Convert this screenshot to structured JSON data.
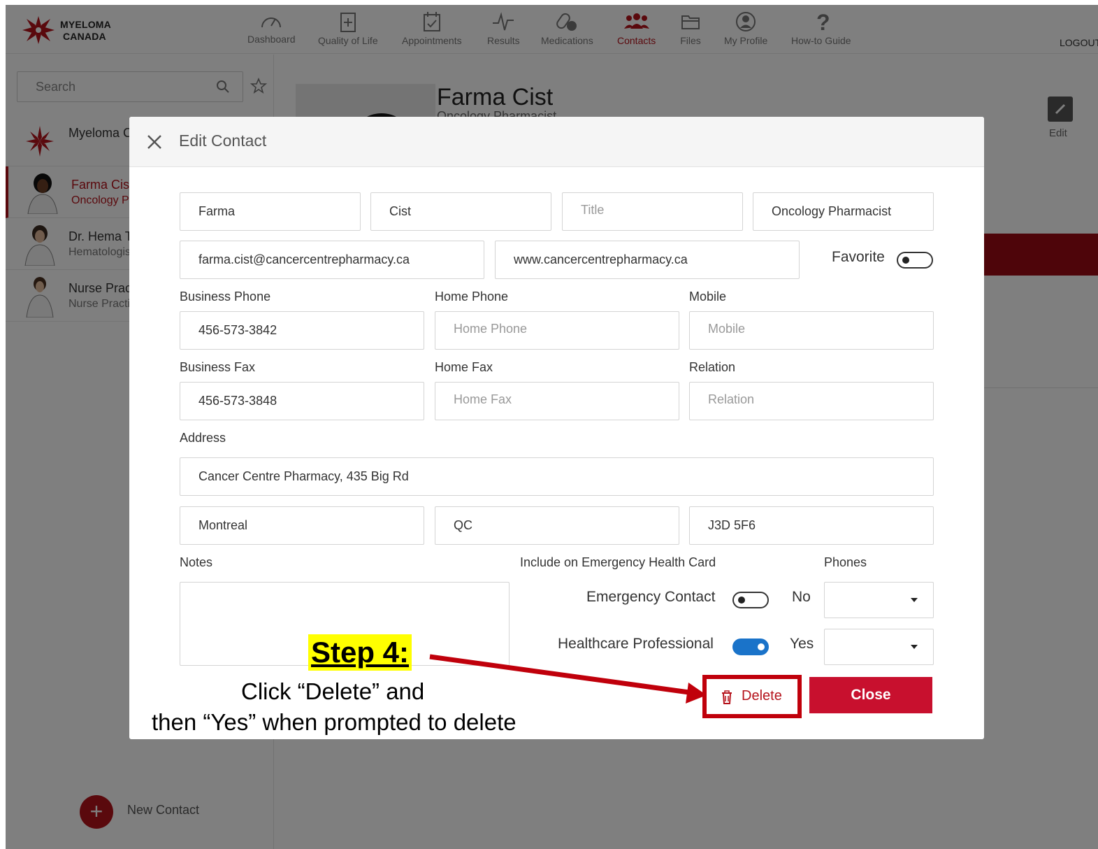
{
  "brand": {
    "line1": "MYELOMA",
    "line2": "CANADA"
  },
  "nav": [
    {
      "label": "Dashboard",
      "icon": "gauge-icon"
    },
    {
      "label": "Quality of Life",
      "icon": "clipboard-plus-icon"
    },
    {
      "label": "Appointments",
      "icon": "calendar-check-icon"
    },
    {
      "label": "Results",
      "icon": "pulse-icon"
    },
    {
      "label": "Medications",
      "icon": "pills-icon"
    },
    {
      "label": "Contacts",
      "icon": "people-icon",
      "active": true
    },
    {
      "label": "Files",
      "icon": "folder-icon"
    },
    {
      "label": "My Profile",
      "icon": "user-circle-icon"
    },
    {
      "label": "How-to Guide",
      "icon": "question-icon"
    }
  ],
  "logout": "LOGOUT",
  "sidebar": {
    "search_placeholder": "Search",
    "contacts": [
      {
        "name": "Myeloma Canada",
        "sub": ""
      },
      {
        "name": "Farma Cist",
        "sub": "Oncology Pharmacist",
        "active": true
      },
      {
        "name": "Dr. Hema T",
        "sub": "Hematologist"
      },
      {
        "name": "Nurse Practitioner",
        "sub": "Nurse Practitioner"
      }
    ],
    "new_contact": "New Contact"
  },
  "detail": {
    "name": "Farma Cist",
    "sub": "Oncology Pharmacist",
    "edit": "Edit"
  },
  "modal": {
    "title": "Edit Contact",
    "first_name": "Farma",
    "last_name": "Cist",
    "title_placeholder": "Title",
    "role": "Oncology Pharmacist",
    "email": "farma.cist@cancercentrepharmacy.ca",
    "website": "www.cancercentrepharmacy.ca",
    "favorite_label": "Favorite",
    "business_phone_label": "Business Phone",
    "business_phone": "456-573-3842",
    "home_phone_label": "Home Phone",
    "home_phone_placeholder": "Home Phone",
    "mobile_label": "Mobile",
    "mobile_placeholder": "Mobile",
    "business_fax_label": "Business Fax",
    "business_fax": "456-573-3848",
    "home_fax_label": "Home Fax",
    "home_fax_placeholder": "Home Fax",
    "relation_label": "Relation",
    "relation_placeholder": "Relation",
    "address_label": "Address",
    "address": "Cancer Centre Pharmacy, 435 Big Rd",
    "city": "Montreal",
    "province": "QC",
    "postal": "J3D 5F6",
    "notes_label": "Notes",
    "emergency_card_label": "Include on Emergency Health Card",
    "phones_label": "Phones",
    "emergency_contact_label": "Emergency Contact",
    "emergency_contact_value": "No",
    "healthcare_label": "Healthcare Professional",
    "healthcare_value": "Yes",
    "delete_label": "Delete",
    "close_label": "Close"
  },
  "annotation": {
    "step": "Step 4:",
    "line1": "Click “Delete” and",
    "line2": "then “Yes” when prompted to delete"
  },
  "colors": {
    "brand_red": "#b5121b",
    "toggle_on": "#1a73c9",
    "highlight": "#ffff00",
    "annotation_red": "#c0000b"
  }
}
